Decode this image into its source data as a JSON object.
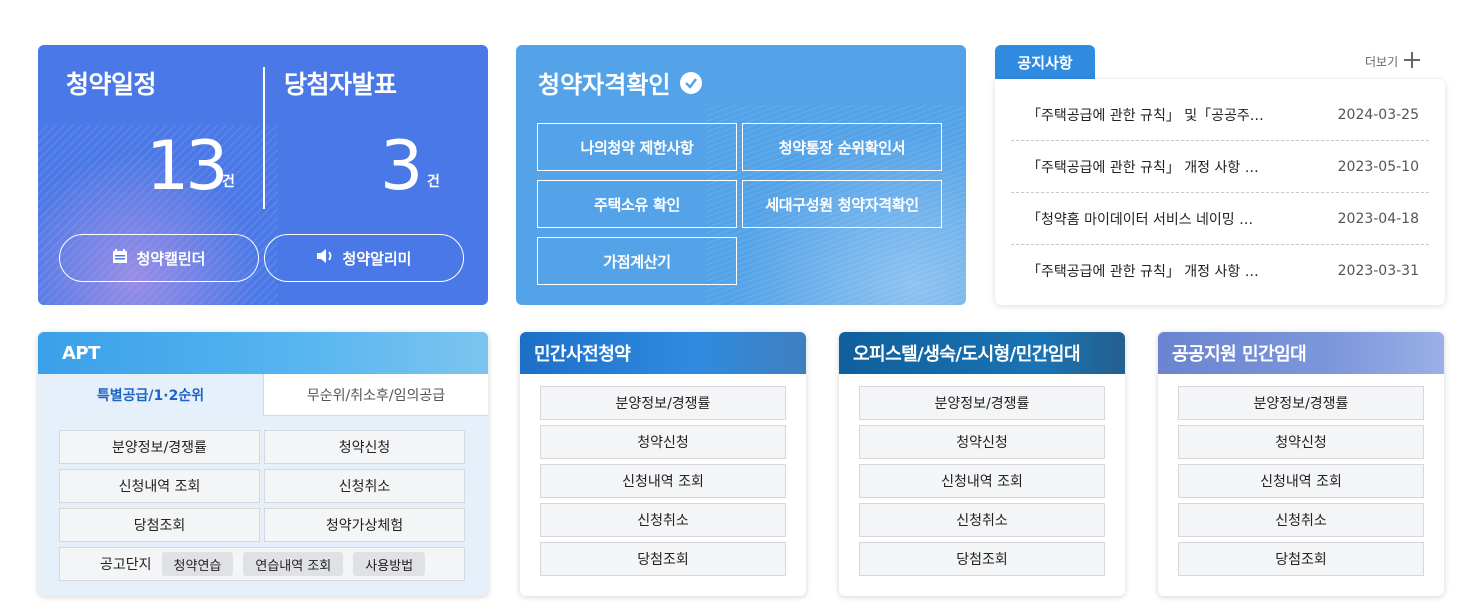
{
  "schedule_card": {
    "title_left": "청약일정",
    "count_left": "13",
    "unit_left": "건",
    "title_right": "당첨자발표",
    "count_right": "3",
    "unit_right": "건",
    "calendar_button": "청약캘린더",
    "alarm_button": "청약알리미"
  },
  "qualify_card": {
    "title": "청약자격확인",
    "buttons": [
      "나의청약 제한사항",
      "청약통장 순위확인서",
      "주택소유 확인",
      "세대구성원 청약자격확인",
      "가점계산기"
    ]
  },
  "notice": {
    "tab_label": "공지사항",
    "more_label": "더보기",
    "items": [
      {
        "title": "「주택공급에 관한 규칙」 및「공공주…",
        "date": "2024-03-25"
      },
      {
        "title": "「주택공급에 관한 규칙」 개정 사항 …",
        "date": "2023-05-10"
      },
      {
        "title": "「청약홈 마이데이터 서비스 네이밍 …",
        "date": "2023-04-18"
      },
      {
        "title": "「주택공급에 관한 규칙」 개정 사항 …",
        "date": "2023-03-31"
      }
    ]
  },
  "apt": {
    "title": "APT",
    "tabs": [
      "특별공급/1·2순위",
      "무순위/취소후/임의공급"
    ],
    "buttons": [
      "분양정보/경쟁률",
      "청약신청",
      "신청내역 조회",
      "신청취소",
      "당첨조회",
      "청약가상체험"
    ],
    "practice_label": "공고단지",
    "practice_buttons": [
      "청약연습",
      "연습내역 조회",
      "사용방법"
    ]
  },
  "presale": {
    "title": "민간사전청약",
    "buttons": [
      "분양정보/경쟁률",
      "청약신청",
      "신청내역 조회",
      "신청취소",
      "당첨조회"
    ]
  },
  "officetel": {
    "title": "오피스텔/생숙/도시형/민간임대",
    "buttons": [
      "분양정보/경쟁률",
      "청약신청",
      "신청내역 조회",
      "신청취소",
      "당첨조회"
    ]
  },
  "public_rental": {
    "title": "공공지원 민간임대",
    "buttons": [
      "분양정보/경쟁률",
      "청약신청",
      "신청내역 조회",
      "신청취소",
      "당첨조회"
    ]
  },
  "colors": {
    "schedule_bg": "#4a78e6",
    "qualify_bg": "#54a3e8",
    "notice_tab": "#2f8be0",
    "apt_active_tab_text": "#1f63c7"
  }
}
